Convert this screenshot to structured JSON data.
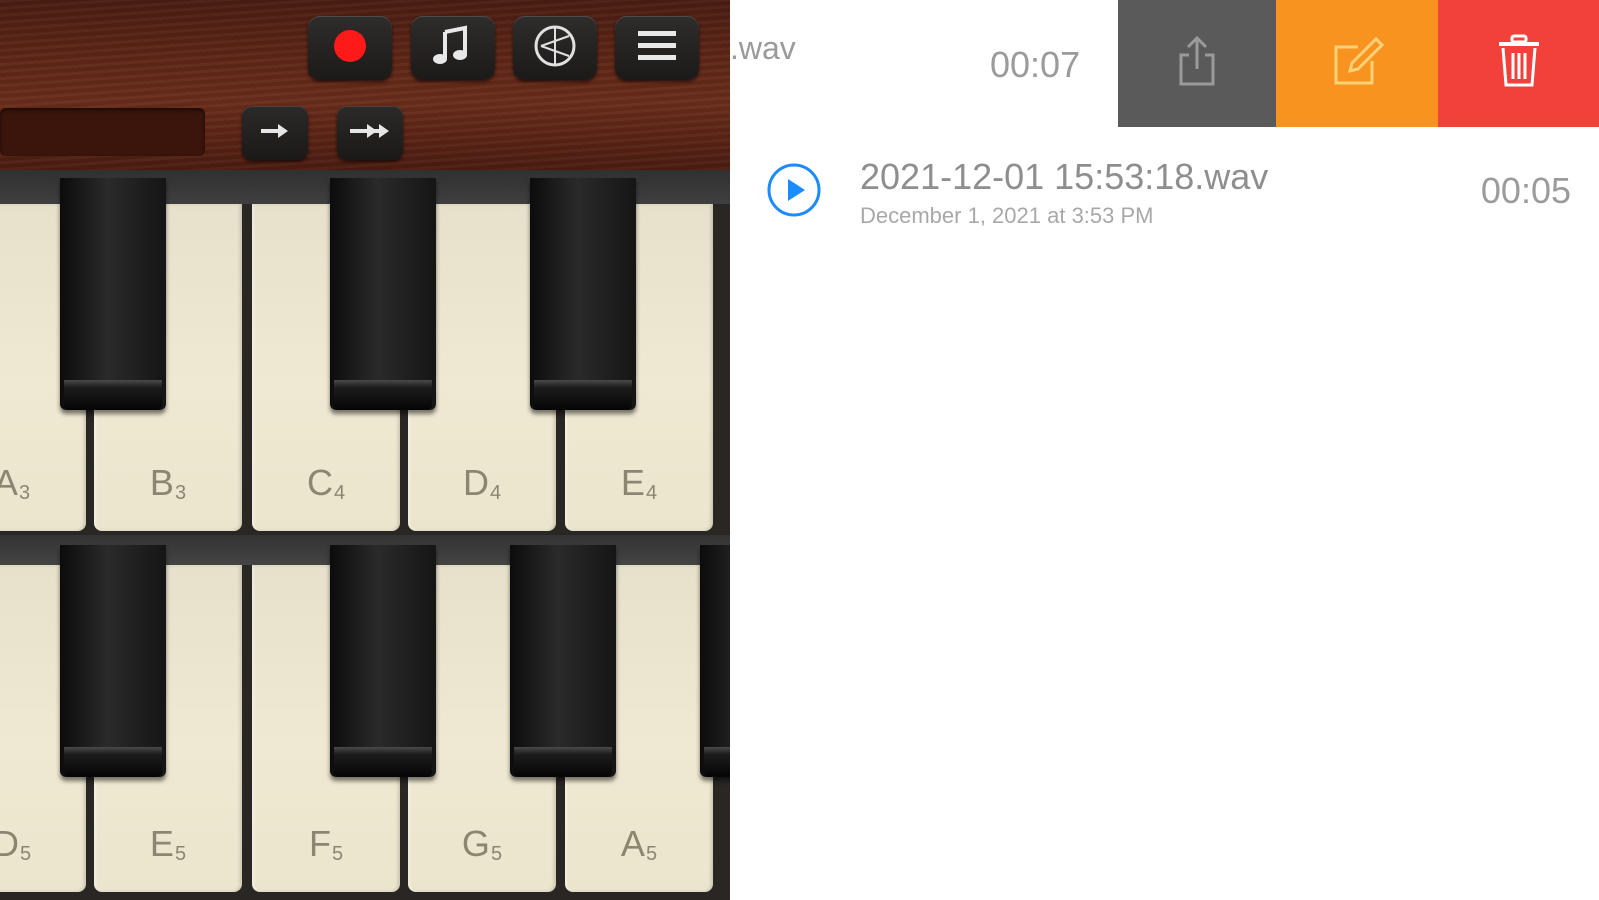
{
  "piano": {
    "toolbar": [
      "record-icon",
      "music-note-icon",
      "metronome-icon",
      "menu-icon"
    ],
    "arrows": [
      "arrow-right-icon",
      "double-arrow-right-icon"
    ],
    "colors": {
      "record": "#ff1a1a",
      "wood": "#5e2617",
      "white_key": "#ece6cf",
      "black_key": "#111111"
    },
    "row1_labels": [
      {
        "note": "A",
        "octave": "3"
      },
      {
        "note": "B",
        "octave": "3"
      },
      {
        "note": "C",
        "octave": "4"
      },
      {
        "note": "D",
        "octave": "4"
      },
      {
        "note": "E",
        "octave": "4"
      }
    ],
    "row2_labels": [
      {
        "note": "D",
        "octave": "5"
      },
      {
        "note": "E",
        "octave": "5"
      },
      {
        "note": "F",
        "octave": "5"
      },
      {
        "note": "G",
        "octave": "5"
      },
      {
        "note": "A",
        "octave": "5"
      }
    ]
  },
  "recordings": {
    "row1": {
      "name_partial": ".wav",
      "duration": "00:07"
    },
    "swipe_actions": {
      "share": {
        "icon": "share-icon",
        "color": "#5a5a5a"
      },
      "edit": {
        "icon": "edit-icon",
        "color": "#f7931e"
      },
      "delete": {
        "icon": "trash-icon",
        "color": "#f2403a"
      }
    },
    "row2": {
      "name": "2021-12-01 15:53:18.wav",
      "date": "December 1, 2021 at 3:53 PM",
      "duration": "00:05",
      "play_icon": "play-icon",
      "accent": "#1a8cff"
    }
  }
}
